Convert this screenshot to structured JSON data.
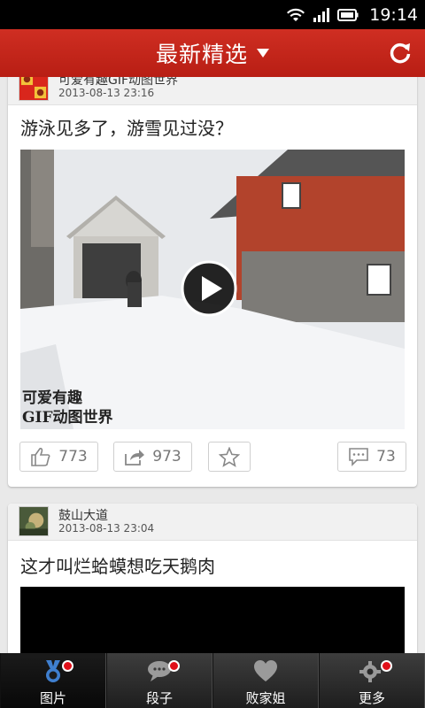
{
  "status_bar": {
    "time": "19:14"
  },
  "header": {
    "title": "最新精选"
  },
  "posts": [
    {
      "author": "可爱有趣GIF动图世界",
      "date": "2013-08-13 23:16",
      "title": "游泳见多了，游雪见过没？",
      "media_watermark_line1": "可爱有趣",
      "media_watermark_line2": "GIF动图世界",
      "likes": "773",
      "shares": "973",
      "comments": "73"
    },
    {
      "author": "鼓山大道",
      "date": "2013-08-13 23:04",
      "title": "这才叫烂蛤蟆想吃天鹅肉"
    }
  ],
  "tabs": [
    {
      "label": "图片",
      "icon": "medal-icon"
    },
    {
      "label": "段子",
      "icon": "chat-bubble-icon"
    },
    {
      "label": "败家姐",
      "icon": "heart-icon"
    },
    {
      "label": "更多",
      "icon": "gear-icon"
    }
  ],
  "colors": {
    "header_red": "#c4261b",
    "badge_red": "#e0101a",
    "tabbar_dark": "#2a2a2a"
  }
}
